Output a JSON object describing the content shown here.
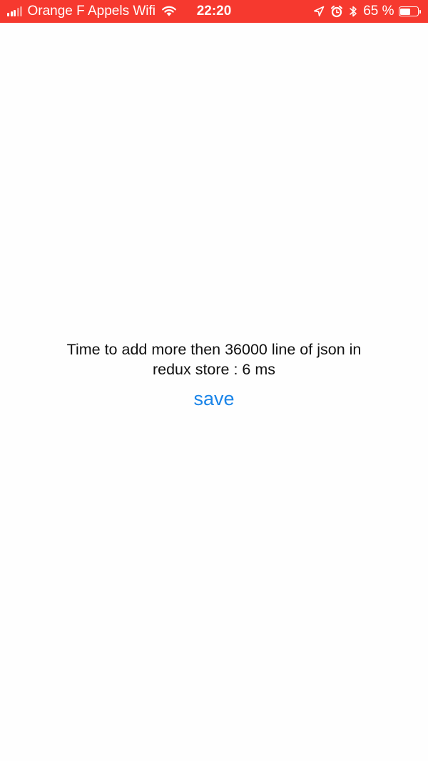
{
  "status_bar": {
    "background": "#f6392f",
    "carrier": "Orange F Appels Wifi",
    "signal_bars_filled": 3,
    "signal_bars_total": 5,
    "time": "22:20",
    "icons": [
      "location-arrow-icon",
      "alarm-clock-icon",
      "bluetooth-icon"
    ],
    "battery_label": "65 %",
    "battery_level": 0.65
  },
  "main": {
    "message": "Time to add more then 36000 line of json in redux store : 6 ms",
    "save_label": "save",
    "accent_color": "#1a84e8"
  }
}
